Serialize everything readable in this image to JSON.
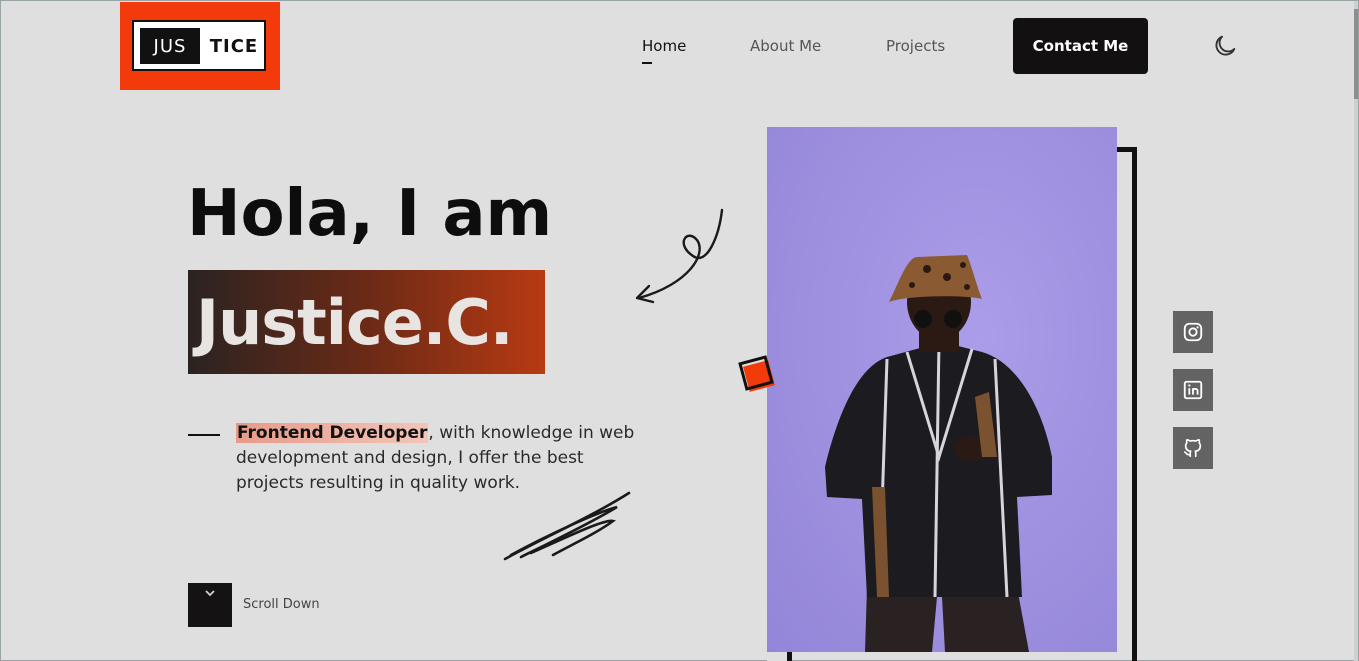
{
  "logo": {
    "part1": "JUS",
    "part2": "TICE",
    "bg_color": "#f23a0b"
  },
  "nav": {
    "items": [
      {
        "label": "Home",
        "active": true
      },
      {
        "label": "About Me",
        "active": false
      },
      {
        "label": "Projects",
        "active": false
      }
    ],
    "contact_label": "Contact Me"
  },
  "theme_toggle_icon": "moon-icon",
  "hero": {
    "greeting": "Hola, I am",
    "name": "Justice.C.",
    "role_highlight": "Frontend Developer",
    "description_rest": ", with knowledge in web development and design, I offer the best projects resulting in quality work.",
    "scroll_label": "Scroll Down"
  },
  "social": [
    {
      "icon": "instagram-icon"
    },
    {
      "icon": "linkedin-icon"
    },
    {
      "icon": "github-icon"
    }
  ],
  "colors": {
    "accent": "#f23a0b",
    "dark": "#121010",
    "background": "#e0dfdf",
    "photo_bg": "#9d8ede"
  }
}
